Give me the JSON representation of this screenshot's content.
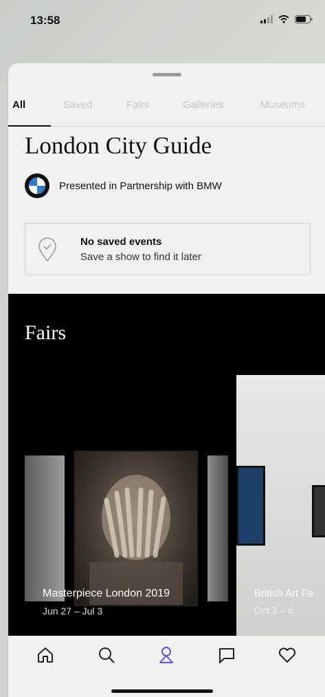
{
  "status_bar": {
    "time": "13:58"
  },
  "tabs": [
    "All",
    "Saved",
    "Fairs",
    "Galleries",
    "Museums"
  ],
  "active_tab": "All",
  "guide": {
    "title": "London City Guide",
    "partner_text": "Presented in Partnership with BMW"
  },
  "saved_events": {
    "title": "No saved events",
    "subtitle": "Save a show to find it later"
  },
  "fairs": {
    "section_title": "Fairs",
    "cards": [
      {
        "title": "Masterpiece London 2019",
        "date": "Jun 27 – Jul 3"
      },
      {
        "title": "British Art Fa",
        "date": "Oct 3 – 6"
      }
    ]
  },
  "bottom_nav": {
    "items": [
      "home-icon",
      "search-icon",
      "city-guide-icon",
      "messages-icon",
      "saved-icon"
    ],
    "active": "city-guide-icon",
    "accent": "#6b4fe0"
  }
}
